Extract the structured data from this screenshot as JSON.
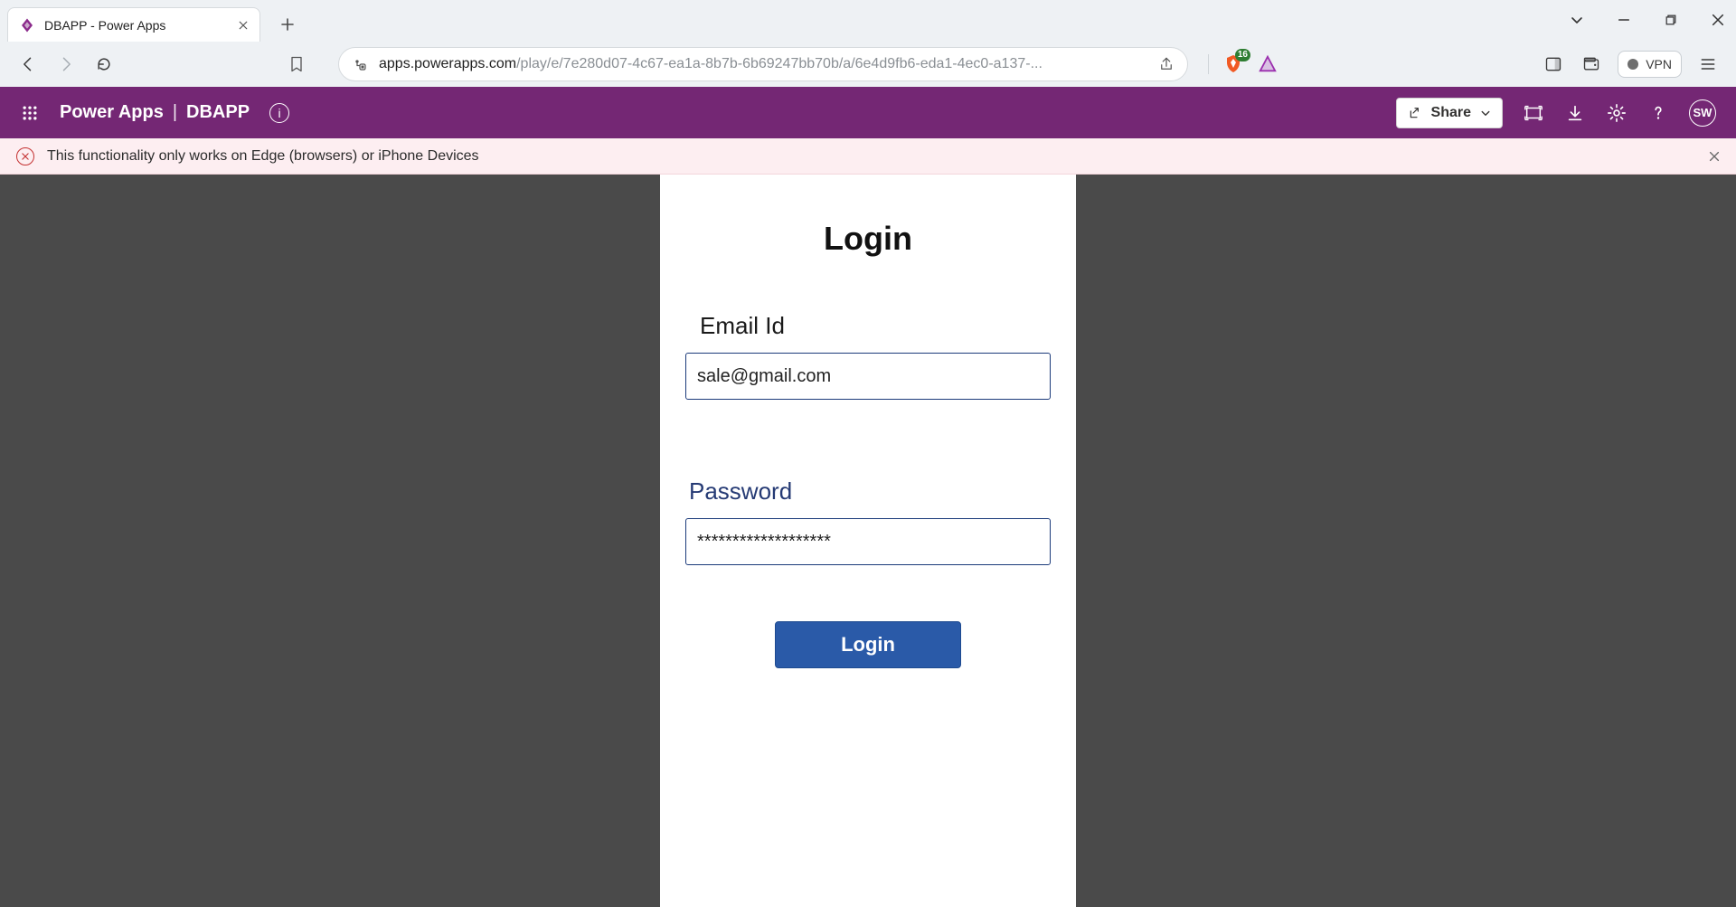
{
  "browser": {
    "tab_title": "DBAPP - Power Apps",
    "url_host": "apps.powerapps.com",
    "url_rest": "/play/e/7e280d07-4c67-ea1a-8b7b-6b69247bb70b/a/6e4d9fb6-eda1-4ec0-a137-...",
    "shield_badge": "16",
    "vpn_label": "VPN"
  },
  "pa_header": {
    "brand_left": "Power Apps",
    "brand_sep": "|",
    "brand_right": "DBAPP",
    "share_label": "Share",
    "avatar_initials": "SW"
  },
  "banner": {
    "message": "This functionality only works on Edge (browsers) or iPhone Devices"
  },
  "login": {
    "title": "Login",
    "email_label": "Email Id",
    "email_value": "sale@gmail.com",
    "password_label": "Password",
    "password_value": "*******************",
    "submit_label": "Login"
  },
  "colors": {
    "pa_purple": "#742774",
    "banner_bg": "#fdeef1",
    "canvas_bg": "#4a4a4a",
    "primary_button": "#2a5aa8",
    "field_border": "#1b3a7a"
  }
}
